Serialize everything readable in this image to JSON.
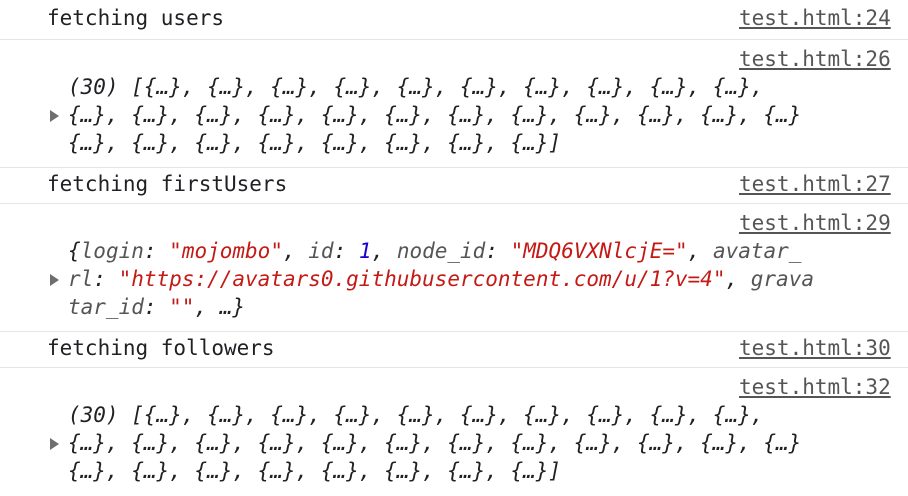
{
  "console": {
    "rows": [
      {
        "message": "fetching users",
        "source": "test.html:24"
      },
      {
        "source": "test.html:26",
        "lines": [
          "(30) [{…}, {…}, {…}, {…}, {…}, {…}, {…}, {…}, {…}, {…},",
          "{…}, {…}, {…}, {…}, {…}, {…}, {…}, {…}, {…}, {…}, {…}, {…}",
          "{…}, {…}, {…}, {…}, {…}, {…}, {…}, {…}]"
        ]
      },
      {
        "message": "fetching firstUsers",
        "source": "test.html:27"
      },
      {
        "source": "test.html:29",
        "object": {
          "open_brace": "{",
          "key_login": "login",
          "colon_sp": ": ",
          "val_login": "\"mojombo\"",
          "comma_sp": ", ",
          "key_id": "id",
          "val_id": "1",
          "key_node_id": "node_id",
          "val_node_id": "\"MDQ6VXNlcjE=\"",
          "key_avatar_part1": "avatar_",
          "key_avatar_part2": "rl",
          "val_avatar_url": "\"https://avatars0.githubusercontent.com/u/1?v=4\"",
          "key_gravatar_part1": "grava",
          "key_gravatar_part2": "tar_id",
          "val_gravatar_id": "\"\"",
          "tail": ", …}"
        }
      },
      {
        "message": "fetching followers",
        "source": "test.html:30"
      },
      {
        "source": "test.html:32",
        "lines": [
          "(30) [{…}, {…}, {…}, {…}, {…}, {…}, {…}, {…}, {…}, {…},",
          "{…}, {…}, {…}, {…}, {…}, {…}, {…}, {…}, {…}, {…}, {…}, {…}",
          "{…}, {…}, {…}, {…}, {…}, {…}, {…}, {…}]"
        ]
      }
    ]
  }
}
